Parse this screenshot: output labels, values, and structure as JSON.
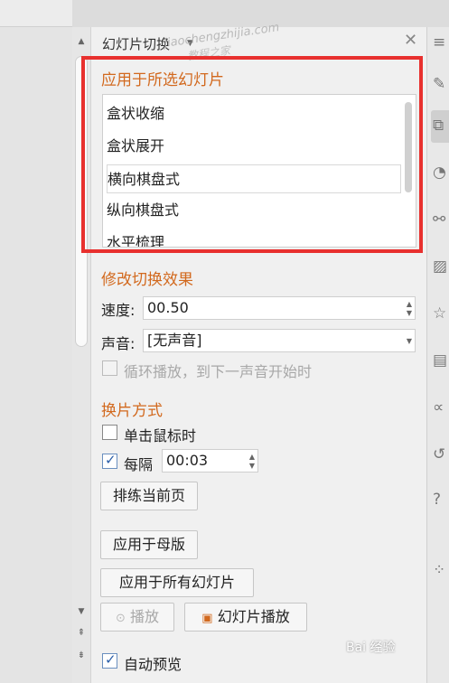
{
  "panel": {
    "title": "幻灯片切换",
    "watermark_url": "jiaochengzhijia.com",
    "watermark_cn": "教程之家"
  },
  "apply_section": {
    "title": "应用于所选幻灯片",
    "items": [
      {
        "label": "盒状收缩"
      },
      {
        "label": "盒状展开"
      },
      {
        "label": "横向棋盘式"
      },
      {
        "label": "纵向棋盘式"
      },
      {
        "label": "水平梳理"
      }
    ],
    "selected_index": 2
  },
  "modify_section": {
    "title": "修改切换效果",
    "speed_label": "速度:",
    "speed_value": "00.50",
    "sound_label": "声音:",
    "sound_value": "[无声音]",
    "loop_label": "循环播放，到下一声音开始时"
  },
  "advance_section": {
    "title": "换片方式",
    "on_click_label": "单击鼠标时",
    "every_label": "每隔",
    "every_value": "00:03",
    "rehearse_label": "排练当前页"
  },
  "buttons": {
    "apply_master": "应用于母版",
    "apply_all": "应用于所有幻灯片",
    "play": "播放",
    "slideshow": "幻灯片播放"
  },
  "auto_preview_label": "自动预览",
  "watermark_bottom": "Bai 经验",
  "colors": {
    "section_title": "#d2691e",
    "highlight": "#e8302e",
    "checkbox_check": "#2a5ea8"
  },
  "icons": [
    "close-icon",
    "chevron-down-icon",
    "spin-up-icon",
    "spin-down-icon",
    "play-icon",
    "slideshow-icon",
    "checkmark-icon"
  ]
}
